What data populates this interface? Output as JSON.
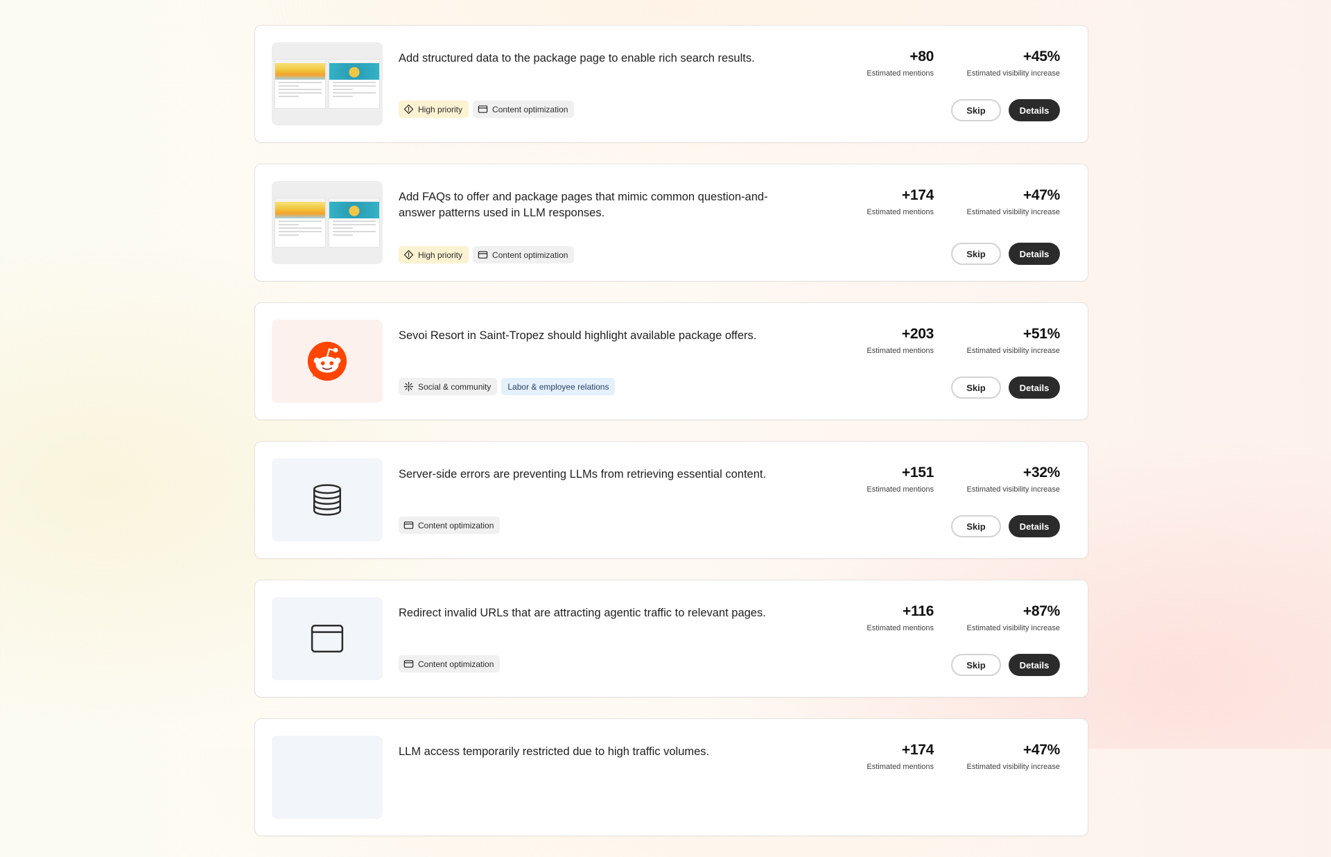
{
  "labels": {
    "mentions": "Estimated mentions",
    "visibility": "Estimated visibility increase",
    "skip": "Skip",
    "details": "Details"
  },
  "cards": [
    {
      "description": "Add structured data to the package page to enable rich search results.",
      "tags": [
        "High priority",
        "Content optimization"
      ],
      "mentions": "+80",
      "visibility": "+45%",
      "thumbnail": "page-screenshots"
    },
    {
      "description": "Add FAQs to offer and package pages that mimic common question-and-answer patterns used in LLM responses.",
      "tags": [
        "High priority",
        "Content optimization"
      ],
      "mentions": "+174",
      "visibility": "+47%",
      "thumbnail": "page-screenshots"
    },
    {
      "description": "Sevoi Resort in Saint-Tropez should highlight available package offers.",
      "tags": [
        "Social & community",
        "Labor & employee relations"
      ],
      "mentions": "+203",
      "visibility": "+51%",
      "thumbnail": "reddit-icon"
    },
    {
      "description": "Server-side errors are preventing LLMs from retrieving essential content.",
      "tags": [
        "Content optimization"
      ],
      "mentions": "+151",
      "visibility": "+32%",
      "thumbnail": "database-icon"
    },
    {
      "description": "Redirect invalid URLs that are attracting agentic traffic to relevant pages.",
      "tags": [
        "Content optimization"
      ],
      "mentions": "+116",
      "visibility": "+87%",
      "thumbnail": "browser-window-icon"
    },
    {
      "description": "LLM access temporarily restricted due to high traffic volumes.",
      "mentions": "+174",
      "visibility": "+47%"
    }
  ],
  "colors": {
    "details_button": "#2b2b2b",
    "priority_tag": "#fbf2d2",
    "labor_tag": "#e4f0fb",
    "reddit_orange": "#ff4500"
  }
}
